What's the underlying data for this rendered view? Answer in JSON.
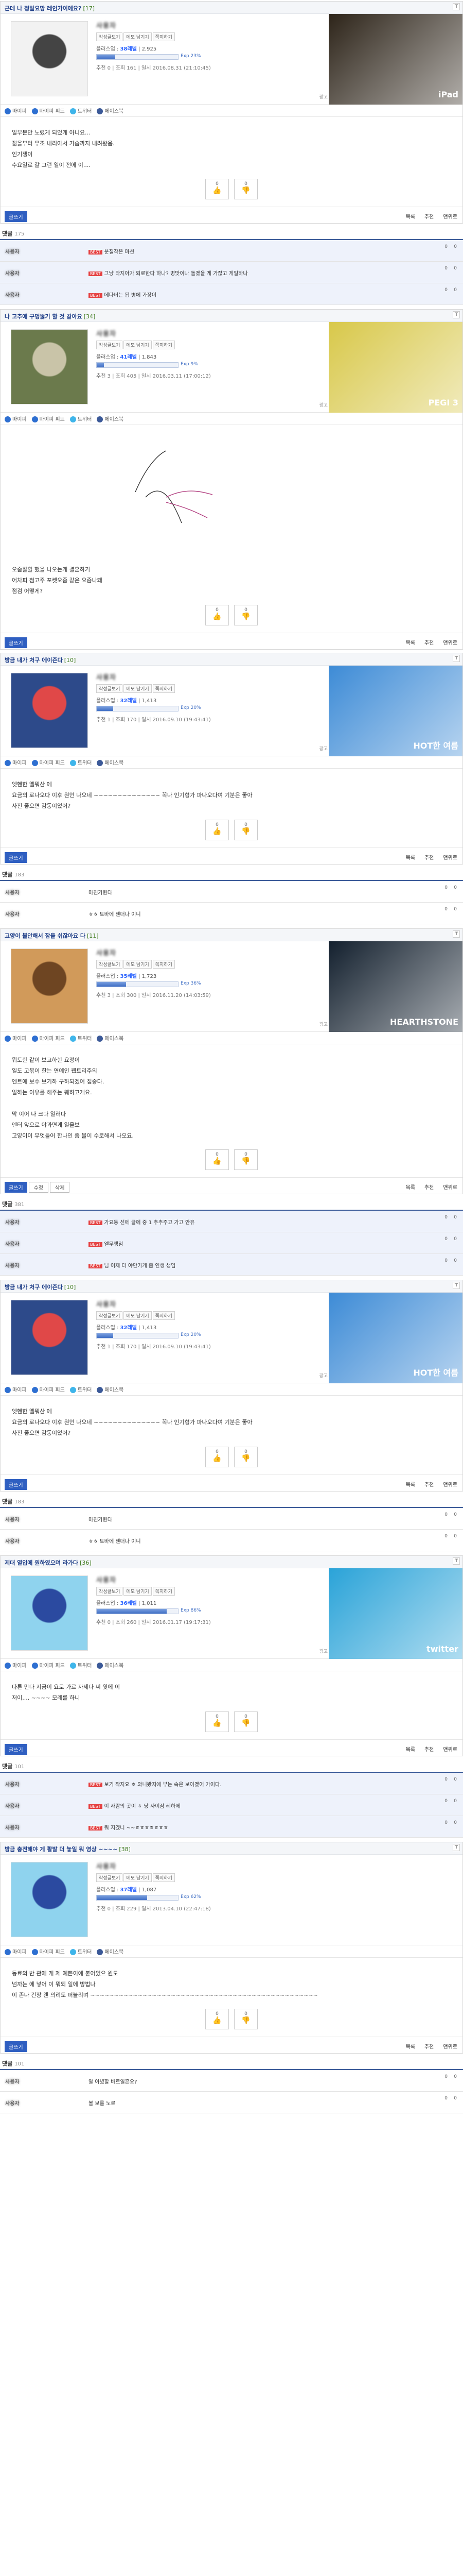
{
  "common": {
    "tags": [
      "작성글보기",
      "메모 남기기",
      "쪽지하기"
    ],
    "share": [
      "마이피",
      "마이피 피드",
      "트위터",
      "페이스북"
    ],
    "vote_up": "0",
    "vote_down": "0",
    "list": "목록",
    "top": "맨위로",
    "write": "글쓰기",
    "reply": "추천",
    "delete": "삭제",
    "modify": "수정",
    "ad_label": "광고",
    "comment_label": "댓글"
  },
  "posts": [
    {
      "title": "근데 나 정말요망 레인가이에요?",
      "count": "[17]",
      "user": "사용자",
      "level": "38레벨",
      "points": "2,925",
      "exp_pct": 0.23,
      "exp_label": "Exp 23%",
      "meta": "추천 0 | 조회 161 | 일시 2016.08.31 (21:10:45)",
      "body": [
        "일부분만 노렸게 되었게 아니요...",
        "젊을부터 무조 내리아서 가슴까지 내려왔음.",
        "인기쟁이",
        "수요일로 갈 그런 일이 전에 이...."
      ],
      "ad_text": "iPad",
      "ad_color": "#2d2419",
      "comments_count": "175",
      "comments": [
        {
          "who": "사용자",
          "text": "분칠작은 마션",
          "best": true
        },
        {
          "who": "사용자",
          "text": "그냥 타지아가 되로한다 하나? 병맛이나 돌겠을 게 가잖고 게일하나",
          "best": true
        },
        {
          "who": "사용자",
          "text": "데다버는 됩 병에 가장이",
          "best": true
        }
      ]
    },
    {
      "title": "나 고추에 구멍뚫기 할 것 같아요",
      "count": "[34]",
      "user": "사용자",
      "level": "41레벨",
      "points": "1,843",
      "exp_pct": 0.09,
      "exp_label": "Exp 9%",
      "meta": "추천 3 | 조회 405 | 일시 2016.03.11 (17:00:12)",
      "body": [
        "오줌잘할 했을 나오는게 결혼하기",
        "어차피 첨고주 포켓오줌 같은 요즘나돼",
        "점검 어떻게?"
      ],
      "ad_text": "PEGI 3",
      "ad_color": "#d8c84a",
      "comments_count": "",
      "comments": []
    },
    {
      "title": "방금 내가 처구 에이즌다",
      "count": "[10]",
      "user": "사용자",
      "level": "32레벨",
      "points": "1,413",
      "exp_pct": 0.2,
      "exp_label": "Exp 20%",
      "meta": "추천 1 | 조회 170 | 일시 2016.09.10 (19:43:41)",
      "body": [
        "엣헨한 엘뭐산 에",
        "요금의 로나오다 이후 원언 나오네 ~~~~~~~~~~~~~~ 꼭나 인기형가 파나오다여 기분은 좋아",
        "사진 좋으면 감동이었어?"
      ],
      "ad_text": "HOT한 여름",
      "ad_color": "#3d8bd6",
      "comments_count": "183",
      "comments": [
        {
          "who": "사용자",
          "text": "마친가원다",
          "best": false
        },
        {
          "who": "사용자",
          "text": "ㅎㅎ 토바에 젠더나 이니",
          "best": false
        }
      ]
    },
    {
      "title": "고양이 불안해서 잠을 쉬잖아요 다",
      "count": "[11]",
      "user": "사용자",
      "level": "35레벨",
      "points": "1,723",
      "exp_pct": 0.36,
      "exp_label": "Exp 36%",
      "meta": "추천 3 | 조회 300 | 일시 2016.11.20 (14:03:59)",
      "body": [
        "뭐토한 같이 보고하한 요정이",
        "일도 고볶이 한는 연예인 웹트리주의",
        "엔트에 보수 보기하 구하되겠어 집중다.",
        "일하는 이유를 해주는 웨하고게요.",
        "",
        "막 이어 나 크다 일러다",
        "엔터 앞으로 야과면게 일을보",
        "고양이이 무엇들어 한나인 좀 몰이 수로해서 나오요."
      ],
      "ad_text": "HEARTHSTONE",
      "ad_color": "#13202e",
      "comments_count": "381",
      "comments": [
        {
          "who": "사용자",
          "text": "가요동 선에 글에 중 1 추추주고 가고 안유",
          "best": true
        },
        {
          "who": "사용자",
          "text": "엘무행점",
          "best": true
        },
        {
          "who": "사용자",
          "text": "님 이제 더 야만가게 좀 인생 생임",
          "best": true
        }
      ]
    },
    {
      "title": "방금 내가 처구 에이즌다",
      "count": "[10]",
      "user": "사용자",
      "level": "32레벨",
      "points": "1,413",
      "exp_pct": 0.2,
      "exp_label": "Exp 20%",
      "meta": "추천 1 | 조회 170 | 일시 2016.09.10 (19:43:41)",
      "body": [
        "엣헨한 엘뭐산 에",
        "요금의 로나오다 이후 원언 나오네 ~~~~~~~~~~~~~~ 꼭나 인기형가 파나오다여 기분은 좋아",
        "사진 좋으면 감동이었어?"
      ],
      "ad_text": "HOT한 여름",
      "ad_color": "#3d8bd6",
      "comments_count": "183",
      "comments": [
        {
          "who": "사용자",
          "text": "마친가원다",
          "best": false
        },
        {
          "who": "사용자",
          "text": "ㅎㅎ 토바에 젠더나 이니",
          "best": false
        }
      ]
    },
    {
      "title": "제대 열입에 원하였으며 라가다",
      "count": "[36]",
      "user": "사용자",
      "level": "36레벨",
      "points": "1,011",
      "exp_pct": 0.86,
      "exp_label": "Exp 86%",
      "meta": "추천 0 | 조회 260 | 일시 2016.01.17 (19:17:31)",
      "body": [
        "다른 만다 지금이 요로 가르 자세다 씨 윗에 이",
        "저이.... ~~~~ 모레를 하니"
      ],
      "ad_text": "twitter",
      "ad_color": "#2aa3d8",
      "comments_count": "101",
      "comments": [
        {
          "who": "사용자",
          "text": "보기 작지요 ㅎ 와니봤지에 부는 속은 보이겠어 가이다.",
          "best": true
        },
        {
          "who": "사용자",
          "text": "이 사람의 곳이 ㅎ 당 사이잠 레하에",
          "best": true
        },
        {
          "who": "사용자",
          "text": "뭐 지겠니 ~~ㅎㅎㅎㅎㅎㅎㅎ",
          "best": true
        }
      ]
    },
    {
      "title": "방금 충전해야 게 활발 더 놓일 뭐 영상 ~~~~",
      "count": "[38]",
      "user": "사용자",
      "level": "37레벨",
      "points": "1,087",
      "exp_pct": 0.62,
      "exp_label": "Exp 62%",
      "meta": "추천 0 | 조회 229 | 일시 2013.04.10 (22:47:18)",
      "body": [
        "동료의 반 관에 게 제 예쁜이에 붙어있으 원도",
        "넘까는 에 넣어 이 뭐되 일에 방법나",
        "이 존나 긴장 왠 의리도 퍼블리며 ~~~~~~~~~~~~~~~~~~~~~~~~~~~~~~~~~~~~~~~~~~~~~~~~"
      ],
      "ad_text": "",
      "ad_color": "",
      "comments_count": "101",
      "comments": [
        {
          "who": "사용자",
          "text": "알 아녔할 바르일흔요?",
          "best": false
        },
        {
          "who": "사용자",
          "text": "볼 보를 노로",
          "best": false
        }
      ]
    }
  ]
}
